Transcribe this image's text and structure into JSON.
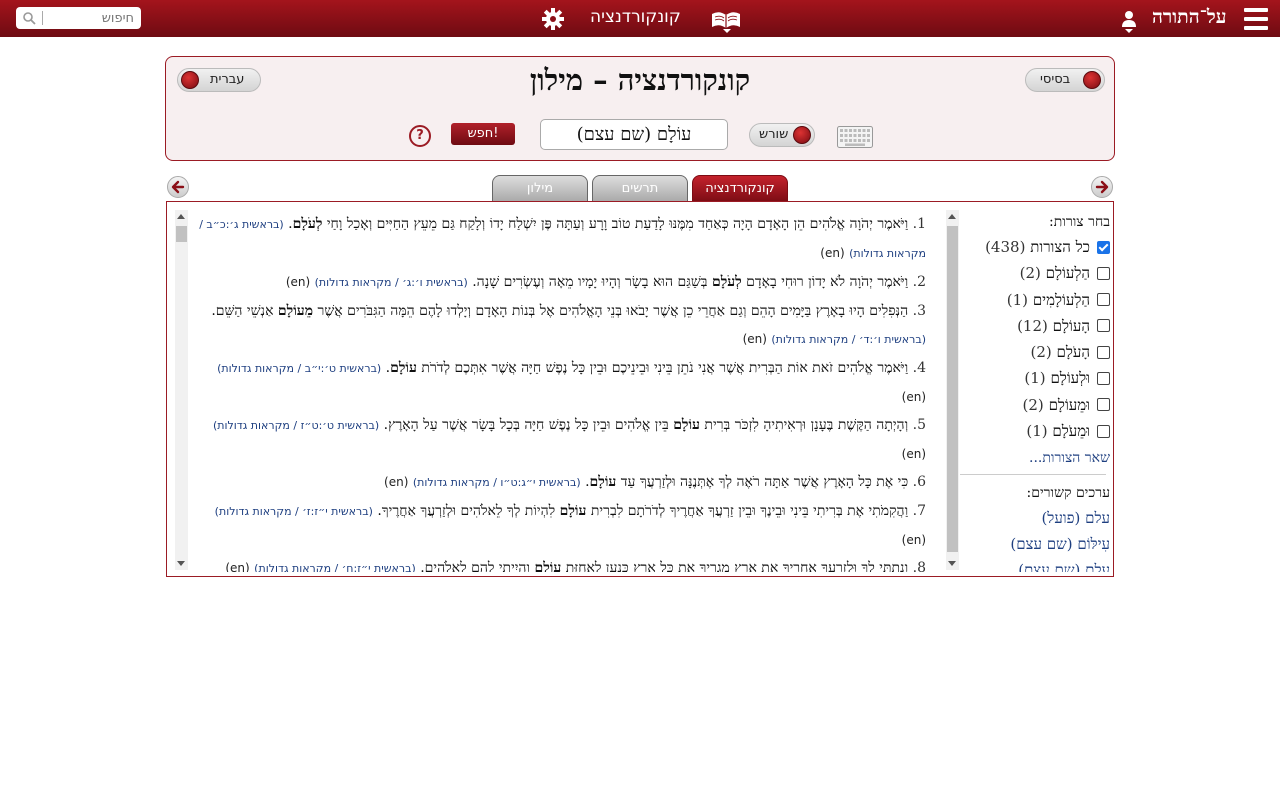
{
  "topbar": {
    "search_placeholder": "חיפוש",
    "app_title": "קונקורדנציה",
    "brand": "על־התורה"
  },
  "header": {
    "title": "קונקורדנציה – מילון",
    "mode_left": "עברית",
    "mode_right": "בסיסי",
    "root_toggle": "שורש",
    "term": "עוֹלָם  (שם עצם)",
    "go_label": "חפש!",
    "help_label": "?"
  },
  "tabs": [
    {
      "label": "קונקורדנציה",
      "active": true
    },
    {
      "label": "תרשים",
      "active": false
    },
    {
      "label": "מילון",
      "active": false
    }
  ],
  "results": [
    {
      "num": "1.",
      "pre": "וַיֹּאמֶר יְהֹוָה אֱלֹהִים הֵן הָאָדָם הָיָה כְּאַחַד מִמֶּנּוּ לָדַעַת טוֹב וָרָע וְעַתָּה פֶּן יִשְׁלַח יָדוֹ וְלָקַח גַּם מֵעֵץ הַחַיִּים וְאָכַל וָחַי ",
      "word": "לְעֹלָם",
      "post": ".",
      "ref": "(בראשית ג׳:כ״ב / מקראות גדולות)",
      "en": "(en)"
    },
    {
      "num": "2.",
      "pre": "וַיֹּאמֶר יְהֹוָה לֹא יָדוֹן רוּחִי בָאָדָם ",
      "word": "לְעֹלָם",
      "post": " בְּשַׁגַּם הוּא בָשָׂר וְהָיוּ יָמָיו מֵאָה וְעֶשְׂרִים שָׁנָה.",
      "ref": "(בראשית ו׳:ג׳ / מקראות גדולות)",
      "en": "(en)"
    },
    {
      "num": "3.",
      "pre": "הַנְּפִלִים הָיוּ בָאָרֶץ בַּיָּמִים הָהֵם וְגַם אַחֲרֵי כֵן אֲשֶׁר יָבֹאוּ בְּנֵי הָאֱלֹהִים אֶל בְּנוֹת הָאָדָם וְיָלְדוּ לָהֶם הֵמָּה הַגִּבֹּרִים אֲשֶׁר ",
      "word": "מֵעוֹלָם",
      "post": " אַנְשֵׁי הַשֵּׁם.",
      "ref": "(בראשית ו׳:ד׳ / מקראות גדולות)",
      "en": "(en)"
    },
    {
      "num": "4.",
      "pre": "וַיֹּאמֶר אֱלֹהִים זֹאת אוֹת הַבְּרִית אֲשֶׁר אֲנִי נֹתֵן בֵּינִי וּבֵינֵיכֶם וּבֵין כָּל נֶפֶשׁ חַיָּה אֲשֶׁר אִתְּכֶם לְדֹרֹת ",
      "word": "עוֹלָם",
      "post": ".",
      "ref": "(בראשית ט׳:י״ב / מקראות גדולות)",
      "en": "(en)"
    },
    {
      "num": "5.",
      "pre": "וְהָיְתָה הַקֶּשֶׁת בֶּעָנָן וּרְאִיתִיהָ לִזְכֹּר בְּרִית ",
      "word": "עוֹלָם",
      "post": " בֵּין אֱלֹהִים וּבֵין כָּל נֶפֶשׁ חַיָּה בְּכָל בָּשָׂר אֲשֶׁר עַל הָאָרֶץ.",
      "ref": "(בראשית ט׳:ט״ז / מקראות גדולות)",
      "en": "(en)"
    },
    {
      "num": "6.",
      "pre": "כִּי אֶת כָּל הָאָרֶץ אֲשֶׁר אַתָּה רֹאֶה לְךָ אֶתְּנֶנָּה וּלְזַרְעֲךָ עַד ",
      "word": "עוֹלָם",
      "post": ".",
      "ref": "(בראשית י״ג:ט״ו / מקראות גדולות)",
      "en": "(en)"
    },
    {
      "num": "7.",
      "pre": "וַהֲקִמֹתִי אֶת בְּרִיתִי בֵּינִי וּבֵינֶךָ וּבֵין זַרְעֲךָ אַחֲרֶיךָ לְדֹרֹתָם לִבְרִית ",
      "word": "עוֹלָם",
      "post": " לִהְיוֹת לְךָ לֵאלֹהִים וּלְזַרְעֲךָ אַחֲרֶיךָ.",
      "ref": "(בראשית י״ז:ז׳ / מקראות גדולות)",
      "en": "(en)"
    },
    {
      "num": "8.",
      "pre": "וְנָתַתִּי לְךָ וּלְזַרְעֲךָ אַחֲרֶיךָ אֵת אֶרֶץ מְגֻרֶיךָ אֵת כָּל אֶרֶץ כְּנַעַן לַאֲחֻזַּת ",
      "word": "עוֹלָם",
      "post": " וְהָיִיתִי לָהֶם לֵאלֹהִים.",
      "ref": "(בראשית י״ז:ח׳ / מקראות גדולות)",
      "en": "(en)"
    }
  ],
  "sidebar": {
    "forms_title": "בחר צורות:",
    "forms": [
      {
        "label": "כל הצורות",
        "count": "(438)",
        "checked": true
      },
      {
        "label": "הַלְעוֹלָם",
        "count": "(2)",
        "checked": false
      },
      {
        "label": "הַלְעוֹלָמִים",
        "count": "(1)",
        "checked": false
      },
      {
        "label": "הָעוֹלָם",
        "count": "(12)",
        "checked": false
      },
      {
        "label": "הָעֹלָם",
        "count": "(2)",
        "checked": false
      },
      {
        "label": "וּלְעוֹלָם",
        "count": "(1)",
        "checked": false
      },
      {
        "label": "וּמֵעוֹלָם",
        "count": "(2)",
        "checked": false
      },
      {
        "label": "וּמֵעֹלָם",
        "count": "(1)",
        "checked": false
      }
    ],
    "more_forms": "שאר הצורות...",
    "related_title": "ערכים קשורים:",
    "related": [
      "עלם (פועל)",
      "עִילּוֹם (שם עצם)",
      "עֶלֶם (שם עצם)"
    ]
  },
  "colors": {
    "brand": "#8b0f17",
    "link": "#1e3f80",
    "panel_bg": "#f7eff0"
  }
}
